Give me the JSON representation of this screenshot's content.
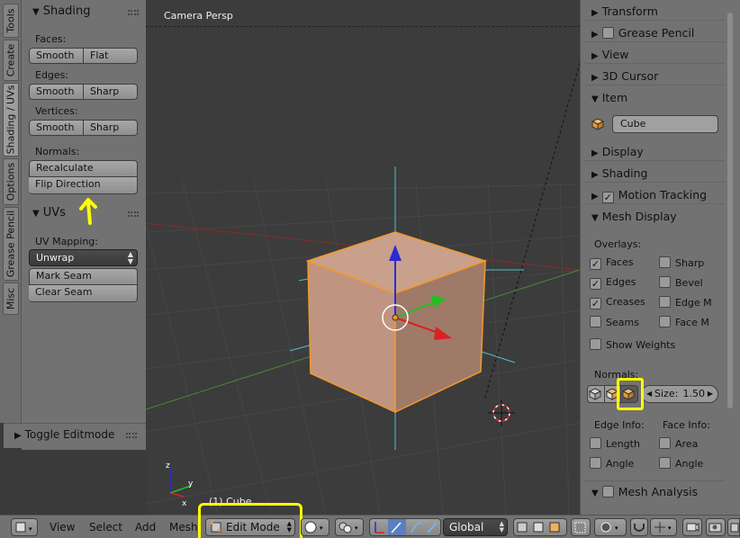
{
  "left_tabs": [
    "Tools",
    "Create",
    "Shading / UVs",
    "Options",
    "Grease Pencil",
    "Misc"
  ],
  "shading": {
    "title": "Shading",
    "faces_label": "Faces:",
    "faces_smooth": "Smooth",
    "faces_flat": "Flat",
    "edges_label": "Edges:",
    "edges_smooth": "Smooth",
    "edges_sharp": "Sharp",
    "vertices_label": "Vertices:",
    "vertices_smooth": "Smooth",
    "vertices_sharp": "Sharp",
    "normals_label": "Normals:",
    "recalculate": "Recalculate",
    "flip_direction": "Flip Direction"
  },
  "uvs": {
    "title": "UVs",
    "uv_mapping_label": "UV Mapping:",
    "unwrap": "Unwrap",
    "mark_seam": "Mark Seam",
    "clear_seam": "Clear Seam"
  },
  "toggle_editmode": "Toggle Editmode",
  "viewport": {
    "title": "Camera Persp",
    "object_label": "(1) Cube"
  },
  "properties": {
    "transform": "Transform",
    "grease_pencil": "Grease Pencil",
    "view": "View",
    "cursor_3d": "3D Cursor",
    "item": "Item",
    "item_name": "Cube",
    "display": "Display",
    "shading": "Shading",
    "motion_tracking": "Motion Tracking",
    "mesh_display": "Mesh Display",
    "overlays_label": "Overlays:",
    "faces": "Faces",
    "edges": "Edges",
    "creases": "Creases",
    "seams": "Seams",
    "sharp": "Sharp",
    "bevel": "Bevel",
    "edge_m": "Edge M",
    "face_m": "Face M",
    "show_weights": "Show Weights",
    "normals_label": "Normals:",
    "size_label": "Size:",
    "size_value": "1.50",
    "edge_info_label": "Edge Info:",
    "face_info_label": "Face Info:",
    "length": "Length",
    "area": "Area",
    "angle_edge": "Angle",
    "angle_face": "Angle",
    "mesh_analysis": "Mesh Analysis"
  },
  "bottom_bar": {
    "view": "View",
    "select": "Select",
    "add": "Add",
    "mesh": "Mesh",
    "mode": "Edit Mode",
    "orientation": "Global"
  },
  "colors": {
    "highlight": "#ffff00",
    "cube_face": "#c59a84",
    "cube_edge": "#f39a2a"
  }
}
